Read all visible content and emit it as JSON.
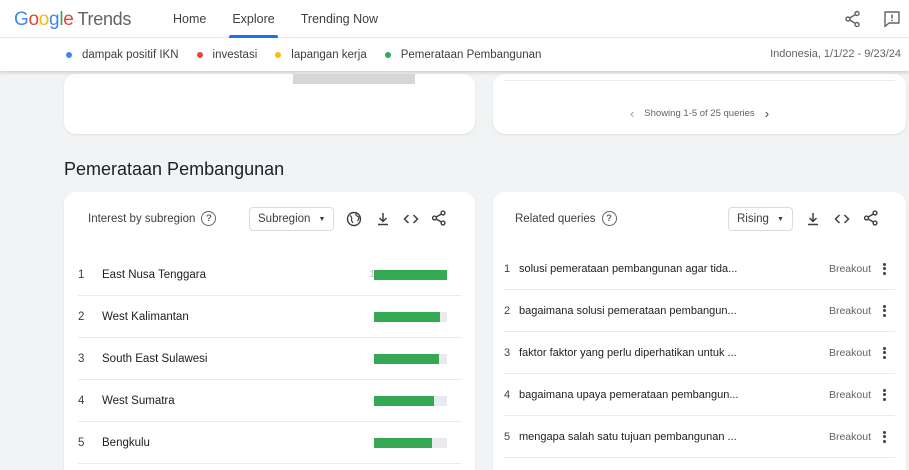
{
  "header": {
    "logo_google": "Google",
    "logo_trends": "Trends",
    "nav": [
      {
        "label": "Home",
        "active": false
      },
      {
        "label": "Explore",
        "active": true
      },
      {
        "label": "Trending Now",
        "active": false
      }
    ],
    "icons": [
      "share-icon",
      "feedback-icon"
    ]
  },
  "compare": {
    "terms": [
      {
        "label": "dampak positif IKN",
        "color": "#4285f4"
      },
      {
        "label": "investasi",
        "color": "#ea4335"
      },
      {
        "label": "lapangan kerja",
        "color": "#fbbc05"
      },
      {
        "label": "Pemerataan Pembangunan",
        "color": "#34a853"
      }
    ],
    "region_date": "Indonesia, 1/1/22 - 9/23/24"
  },
  "prev_section": {
    "pager_text": "Showing 1-5 of 25 queries"
  },
  "section": {
    "title": "Pemerataan Pembangunan"
  },
  "subregion": {
    "title": "Interest by subregion",
    "dropdown": "Subregion",
    "rows": [
      {
        "rank": "1",
        "name": "East Nusa Tenggara",
        "value": 100
      },
      {
        "rank": "2",
        "name": "West Kalimantan",
        "value": 91
      },
      {
        "rank": "3",
        "name": "South East Sulawesi",
        "value": 89
      },
      {
        "rank": "4",
        "name": "West Sumatra",
        "value": 82
      },
      {
        "rank": "5",
        "name": "Bengkulu",
        "value": 80
      }
    ],
    "bar_color": "#34a853"
  },
  "queries": {
    "title": "Related queries",
    "dropdown": "Rising",
    "rows": [
      {
        "rank": "1",
        "text": "solusi pemerataan pembangunan agar tida...",
        "status": "Breakout"
      },
      {
        "rank": "2",
        "text": "bagaimana solusi pemerataan pembangun...",
        "status": "Breakout"
      },
      {
        "rank": "3",
        "text": "faktor faktor yang perlu diperhatikan untuk ...",
        "status": "Breakout"
      },
      {
        "rank": "4",
        "text": "bagaimana upaya pemerataan pembangun...",
        "status": "Breakout"
      },
      {
        "rank": "5",
        "text": "mengapa salah satu tujuan pembangunan ...",
        "status": "Breakout"
      }
    ]
  }
}
